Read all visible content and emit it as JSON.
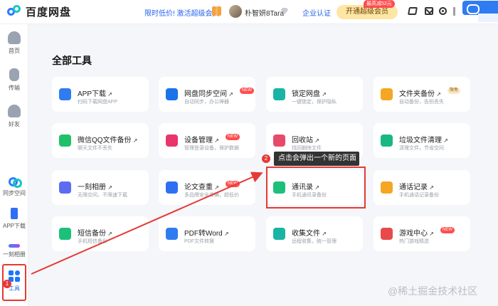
{
  "header": {
    "logo_text": "百度网盘",
    "promo_text": "限时低价! 激活超级会员",
    "username": "朴智妍8Tara",
    "verify_text": "企业认证",
    "vip_button": "开通超级会员",
    "vip_badge": "最高减52元"
  },
  "sidebar": {
    "items": [
      {
        "label": "首页",
        "icon": "home-icon"
      },
      {
        "label": "传输",
        "icon": "transfer-icon"
      },
      {
        "label": "好友",
        "icon": "friends-icon"
      },
      {
        "label": "同步空间",
        "icon": "sync-icon"
      },
      {
        "label": "APP下载",
        "icon": "phone-icon"
      },
      {
        "label": "一刻相册",
        "icon": "album-icon"
      },
      {
        "label": "工具",
        "icon": "grid-icon"
      }
    ]
  },
  "main": {
    "title": "全部工具",
    "tools": [
      {
        "name": "APP下载",
        "desc": "扫码下载网盘APP",
        "color": "#2f7bf2"
      },
      {
        "name": "网盘同步空间",
        "desc": "自动同步，办公神器",
        "tag": "NEW",
        "color": "#1a73e8"
      },
      {
        "name": "锁定网盘",
        "desc": "一键锁定，保护隐私",
        "color": "#19b4a4"
      },
      {
        "name": "文件夹备份",
        "desc": "自动备份，告别丢失",
        "tag": "限免",
        "color": "#f5a623"
      },
      {
        "name": "微信QQ文件备份",
        "desc": "聊天文件不丢失",
        "color": "#21c06b"
      },
      {
        "name": "设备管理",
        "desc": "管理登录设备，保护数据",
        "tag": "NEW",
        "color": "#e8356b"
      },
      {
        "name": "回收站",
        "desc": "找回删除文件",
        "color": "#e84a6a"
      },
      {
        "name": "垃圾文件清理",
        "desc": "清理文件，节省空间",
        "color": "#19b883"
      },
      {
        "name": "一刻相册",
        "desc": "无限空间，不限速下载",
        "color": "#5b6cf3"
      },
      {
        "name": "论文查重",
        "desc": "多品牌安全准确，超低价",
        "tag": "NEW",
        "color": "#2f6ff2"
      },
      {
        "name": "通讯录",
        "desc": "手机通讯录备份",
        "color": "#1cc07a"
      },
      {
        "name": "通话记录",
        "desc": "手机通话记录备份",
        "color": "#f5a623"
      },
      {
        "name": "短信备份",
        "desc": "手机短信备份",
        "color": "#1cc07a"
      },
      {
        "name": "PDF转Word",
        "desc": "PDF文件转换",
        "color": "#2f7bf2"
      },
      {
        "name": "收集文件",
        "desc": "远程收集，统一管理",
        "tag": "",
        "color": "#19b4a4"
      },
      {
        "name": "游戏中心",
        "desc": "热门游戏精选",
        "tag": "NEW",
        "color": "#e84a4a"
      }
    ]
  },
  "annotation": {
    "marker_1": "1",
    "marker_2": "2",
    "tooltip": "点击会弹出一个新的页面",
    "arrow_color": "#e53935"
  },
  "watermark": "@稀土掘金技术社区"
}
